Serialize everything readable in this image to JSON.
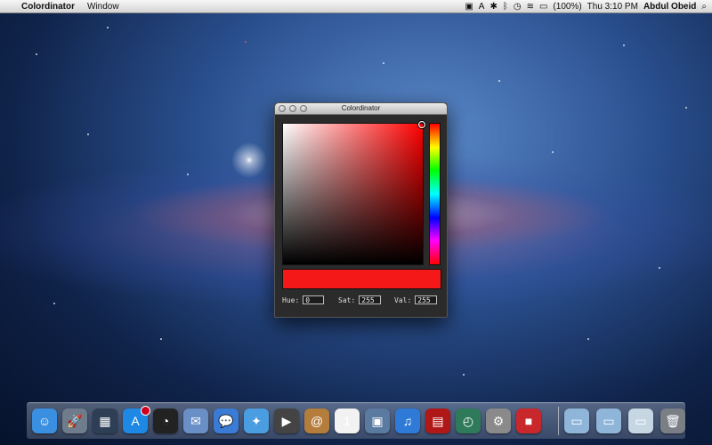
{
  "menubar": {
    "apple_glyph": "",
    "app_name": "Colordinator",
    "menus": [
      "Window"
    ],
    "battery_label": "(100%)",
    "clock": "Thu 3:10 PM",
    "user": "Abdul Obeid"
  },
  "window": {
    "title": "Colordinator",
    "hue_label": "Hue:",
    "hue_value": "0",
    "sat_label": "Sat:",
    "sat_value": "255",
    "val_label": "Val:",
    "val_value": "255",
    "selected_color": "#f51818"
  },
  "dock": {
    "items": [
      {
        "name": "finder-icon",
        "glyph": "☺",
        "color": "#3b8fe0"
      },
      {
        "name": "launchpad-icon",
        "glyph": "🚀",
        "color": "#6e7c8c"
      },
      {
        "name": "mission-control-icon",
        "glyph": "▦",
        "color": "#2d3e55"
      },
      {
        "name": "app-store-icon",
        "glyph": "A",
        "color": "#1e88e5"
      },
      {
        "name": "dashboard-icon",
        "glyph": "◔",
        "color": "#222"
      },
      {
        "name": "mail-icon",
        "glyph": "✉",
        "color": "#6a8fc7"
      },
      {
        "name": "ichat-icon",
        "glyph": "💬",
        "color": "#3a7bd5"
      },
      {
        "name": "safari-icon",
        "glyph": "✦",
        "color": "#4a9de0"
      },
      {
        "name": "facetime-icon",
        "glyph": "▶",
        "color": "#444"
      },
      {
        "name": "address-book-icon",
        "glyph": "@",
        "color": "#b57d3c"
      },
      {
        "name": "ical-icon",
        "glyph": "1",
        "color": "#f2f2f2"
      },
      {
        "name": "iphoto-icon",
        "glyph": "▣",
        "color": "#5a7aa0"
      },
      {
        "name": "itunes-icon",
        "glyph": "♫",
        "color": "#2f7ad6"
      },
      {
        "name": "photo-booth-icon",
        "glyph": "▤",
        "color": "#b01818"
      },
      {
        "name": "time-machine-icon",
        "glyph": "◴",
        "color": "#2f7a5a"
      },
      {
        "name": "system-preferences-icon",
        "glyph": "⚙",
        "color": "#8a8a8a"
      },
      {
        "name": "colordinator-icon",
        "glyph": "■",
        "color": "#c8272c"
      },
      {
        "name": "applications-folder-icon",
        "glyph": "▭",
        "color": "#8fb6d8"
      },
      {
        "name": "documents-folder-icon",
        "glyph": "▭",
        "color": "#8fb6d8"
      },
      {
        "name": "downloads-stack-icon",
        "glyph": "▭",
        "color": "#c7d6e3"
      },
      {
        "name": "trash-icon",
        "glyph": "🗑",
        "color": "#7a7f86"
      }
    ]
  }
}
